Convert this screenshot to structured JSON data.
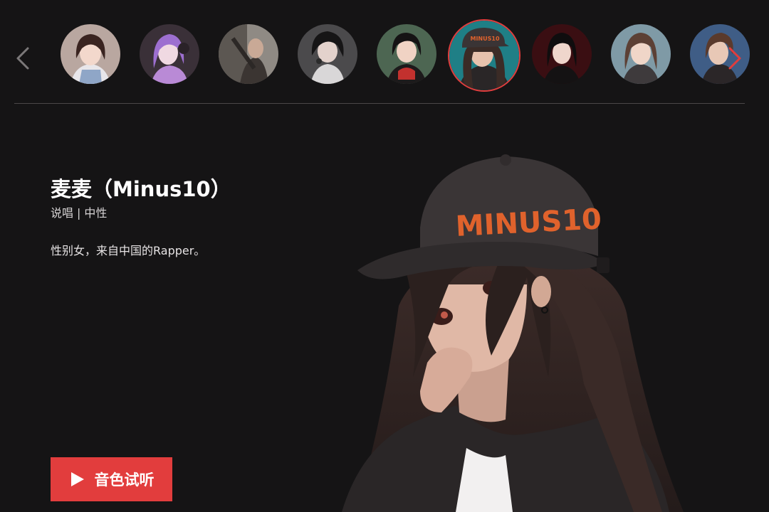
{
  "carousel": {
    "prev_icon": "chevron-left-icon",
    "next_icon": "chevron-right-icon",
    "arrow_color": "#e23d3d",
    "arrow_disabled_color": "#7b7879",
    "selected_index": 5,
    "avatars": [
      {
        "name": "avatar-1"
      },
      {
        "name": "avatar-2"
      },
      {
        "name": "avatar-3"
      },
      {
        "name": "avatar-4"
      },
      {
        "name": "avatar-5"
      },
      {
        "name": "avatar-6"
      },
      {
        "name": "avatar-7"
      },
      {
        "name": "avatar-8"
      },
      {
        "name": "avatar-9"
      }
    ]
  },
  "profile": {
    "name": "麦麦（Minus10）",
    "tag_style": "说唱",
    "tag_separator": "|",
    "tag_gender": "中性",
    "description": "性别女，来自中国的Rapper。",
    "cap_text": "MINUS10"
  },
  "actions": {
    "listen_label": "音色试听",
    "listen_icon": "play-icon",
    "accent": "#e23d3d"
  }
}
